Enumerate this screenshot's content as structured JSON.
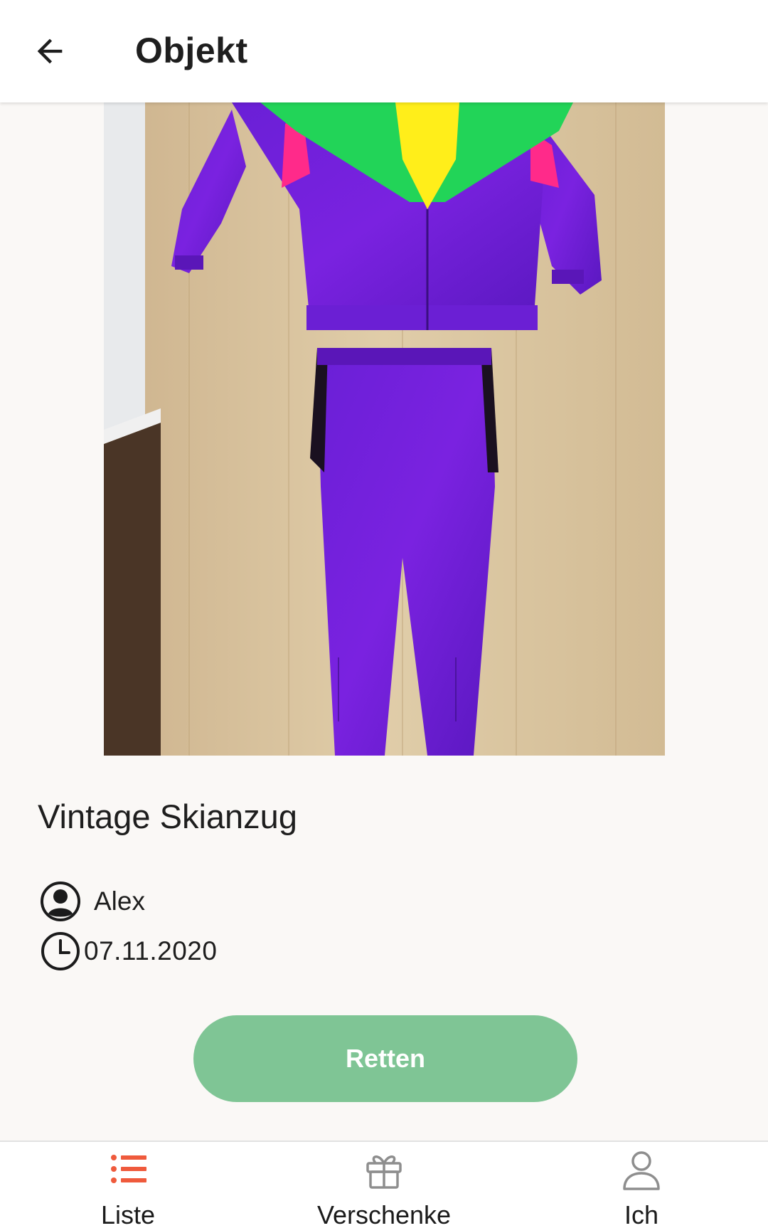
{
  "header": {
    "back_icon": "arrow-left-icon",
    "title": "Objekt"
  },
  "item": {
    "photo_description_icon": "item-photo",
    "title": "Vintage Skianzug",
    "user_icon": "account-circle-icon",
    "user": "Alex",
    "date_icon": "clock-icon",
    "date": "07.11.2020"
  },
  "actions": {
    "rescue_label": "Retten",
    "rescue_color": "#7fc595"
  },
  "bottom_nav": {
    "active_color": "#ef5a3c",
    "items": [
      {
        "label": "Liste",
        "icon": "list-icon",
        "active": true
      },
      {
        "label": "Verschenke",
        "icon": "gift-icon",
        "active": false
      },
      {
        "label": "Ich",
        "icon": "person-icon",
        "active": false
      }
    ]
  }
}
